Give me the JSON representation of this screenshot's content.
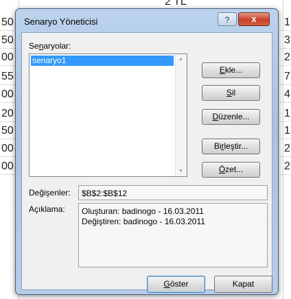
{
  "sheet": {
    "left_values": [
      "50",
      "50",
      "00",
      "55",
      "00",
      "20",
      "50",
      "00",
      "00"
    ],
    "right_values": [
      "1",
      "3",
      "2",
      "7",
      "4",
      "1",
      "1",
      "2",
      "2"
    ],
    "top_cell": "2 TL"
  },
  "dialog": {
    "title": "Senaryo Yöneticisi",
    "help_symbol": "?",
    "close_symbol": "x",
    "scenarios_label_pre": "Se",
    "scenarios_label_key": "n",
    "scenarios_label_post": "aryolar:",
    "scenarios": [
      "senaryo1"
    ],
    "buttons": {
      "add": {
        "pre": "",
        "key": "E",
        "post": "kle..."
      },
      "delete": {
        "pre": "",
        "key": "S",
        "post": "il"
      },
      "edit": {
        "pre": "",
        "key": "D",
        "post": "üzenle..."
      },
      "merge": {
        "pre": "Bi",
        "key": "r",
        "post": "leştir..."
      },
      "summary": {
        "pre": "",
        "key": "Ö",
        "post": "zet..."
      },
      "show": {
        "pre": "",
        "key": "G",
        "post": "öster"
      },
      "close": {
        "pre": "",
        "key": "",
        "post": "Kapat"
      }
    },
    "changing_cells_label": "Değişenler:",
    "changing_cells_value": "$B$2:$B$12",
    "comment_label": "Açıklama:",
    "comment_lines": [
      "Oluşturan: badinogo - 16.03.2011",
      "Değiştiren: badinogo - 16.03.2011"
    ]
  },
  "colors": {
    "selection": "#3399ff",
    "close_button": "#c7402a",
    "dialog_frame": "#a9c2e0"
  }
}
